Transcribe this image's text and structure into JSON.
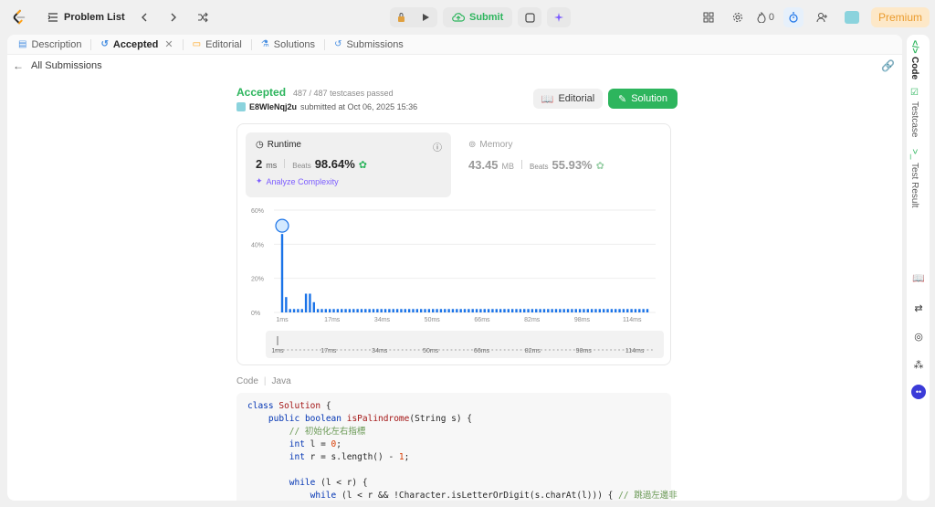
{
  "topbar": {
    "problem_list": "Problem List",
    "submit": "Submit",
    "streak": "0",
    "premium": "Premium"
  },
  "tabs": [
    "Description",
    "Accepted",
    "Editorial",
    "Solutions",
    "Submissions"
  ],
  "back_label": "All Submissions",
  "result": {
    "status": "Accepted",
    "testcases": "487 / 487 testcases passed",
    "user": "E8WIeNqj2u",
    "submitted": "submitted at Oct 06, 2025 15:36",
    "editorial_btn": "Editorial",
    "solution_btn": "Solution"
  },
  "runtime": {
    "label": "Runtime",
    "value": "2",
    "unit": "ms",
    "beats_label": "Beats",
    "beats": "98.64%",
    "analyze": "Analyze Complexity"
  },
  "memory": {
    "label": "Memory",
    "value": "43.45",
    "unit": "MB",
    "beats_label": "Beats",
    "beats": "55.93%"
  },
  "chart_data": {
    "type": "bar",
    "x_ticks": [
      "1ms",
      "17ms",
      "34ms",
      "50ms",
      "66ms",
      "82ms",
      "98ms",
      "114ms"
    ],
    "y_ticks": [
      "60%",
      "40%",
      "20%",
      "0%"
    ],
    "ylim": [
      0,
      60
    ],
    "values": [
      46,
      9,
      2,
      2,
      2,
      2,
      11,
      11,
      6,
      2,
      2,
      2,
      2,
      2,
      2,
      2,
      2,
      2,
      2,
      2,
      2,
      2,
      2,
      2,
      2,
      2,
      2,
      2,
      2,
      2,
      2,
      2,
      2,
      2,
      2,
      2,
      2,
      2,
      2,
      2,
      2,
      2,
      2,
      2,
      2,
      2,
      2,
      2,
      2,
      2,
      2,
      2,
      2,
      2,
      2,
      2,
      2,
      2,
      2,
      2,
      2,
      2,
      2,
      2,
      2,
      2,
      2,
      2,
      2,
      2,
      2,
      2,
      2,
      2,
      2,
      2,
      2,
      2,
      2,
      2,
      2,
      2,
      2,
      2,
      2,
      2,
      2,
      2,
      2,
      2,
      2,
      2,
      2
    ],
    "highlight_index": 0,
    "accent": "#1a73e8"
  },
  "code": {
    "label": "Code",
    "lang": "Java",
    "lines": [
      "class Solution {",
      "    public boolean isPalindrome(String s) {",
      "        // 初始化左右指標",
      "        int l = 0;",
      "        int r = s.length() - 1;",
      "",
      "        while (l < r) {",
      "            while (l < r && !Character.isLetterOrDigit(s.charAt(l))) { // 跳過左邊非"
    ]
  },
  "sidebar": [
    "Code",
    "Testcase",
    "Test Result"
  ]
}
